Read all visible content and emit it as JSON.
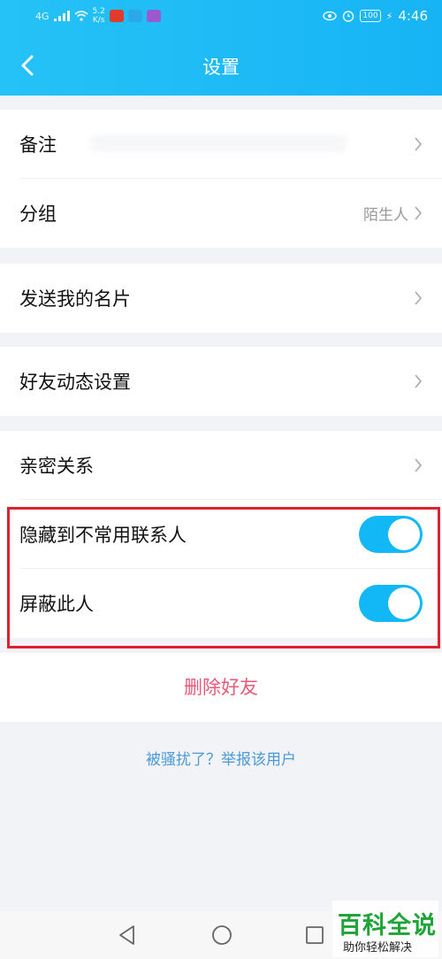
{
  "status_bar": {
    "network": "4G",
    "speed_value": "5.2",
    "speed_unit": "K/s",
    "battery": "100",
    "time": "4:46",
    "colors": {
      "app1": "#e23b2e",
      "app2": "#2aa8e8",
      "app3": "#9b59d0"
    }
  },
  "header": {
    "title": "设置",
    "back_icon": "chevron-left-icon"
  },
  "groups": [
    {
      "items": [
        {
          "label": "备注"
        },
        {
          "label": "分组",
          "value": "陌生人"
        }
      ]
    },
    {
      "items": [
        {
          "label": "发送我的名片"
        }
      ]
    },
    {
      "items": [
        {
          "label": "好友动态设置"
        }
      ]
    },
    {
      "items": [
        {
          "label": "亲密关系"
        },
        {
          "label": "隐藏到不常用联系人",
          "toggle": "on"
        },
        {
          "label": "屏蔽此人",
          "toggle": "on"
        }
      ]
    }
  ],
  "delete_label": "删除好友",
  "report_label": "被骚扰了？举报该用户",
  "navbar": {
    "icons": [
      "back-triangle-icon",
      "home-circle-icon",
      "recents-square-icon"
    ]
  },
  "watermark": {
    "title": "百科全说",
    "subtitle": "助你轻松解决"
  },
  "colors": {
    "accent": "#12b7f5",
    "delete": "#ea5a78",
    "link": "#4a9ad6",
    "highlight": "#e0202e"
  }
}
